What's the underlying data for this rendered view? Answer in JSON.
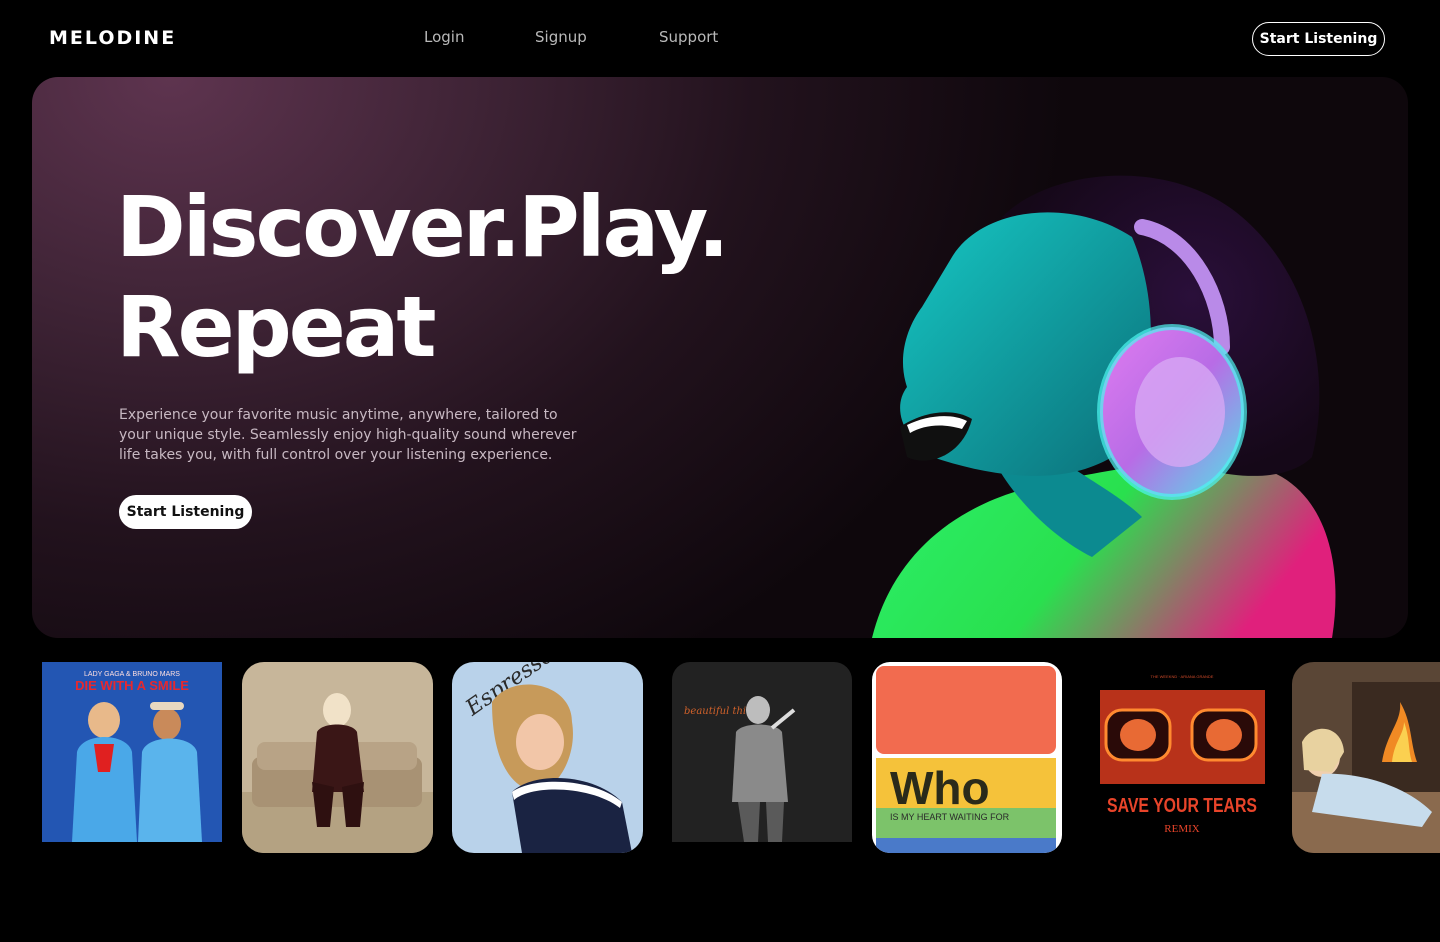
{
  "nav": {
    "logo": "MELODINE",
    "links": [
      "Login",
      "Signup",
      "Support"
    ],
    "cta_label": "Start Listening"
  },
  "hero": {
    "headline_line1": "Discover.Play.",
    "headline_line2": "Repeat",
    "description": "Experience your favorite music anytime, anywhere, tailored to your unique style. Seamlessly enjoy high-quality sound wherever life takes you, with full control over your listening experience.",
    "cta_label": "Start Listening"
  },
  "albums": [
    {
      "cover_artist": "LADY GAGA & BRUNO MARS",
      "cover_title": "DIE WITH A SMILE"
    },
    {
      "cover_artist": "",
      "cover_title": ""
    },
    {
      "cover_artist": "",
      "cover_title": "Espresso"
    },
    {
      "cover_artist": "",
      "cover_title": "beautiful things"
    },
    {
      "cover_artist": "",
      "cover_title": "Who",
      "cover_subtitle": "IS MY HEART WAITING FOR"
    },
    {
      "cover_artist": "THE WEEKND · ARIANA GRANDE",
      "cover_title": "SAVE YOUR TEARS",
      "cover_subtitle": "REMIX"
    },
    {
      "cover_artist": "",
      "cover_title": ""
    }
  ]
}
